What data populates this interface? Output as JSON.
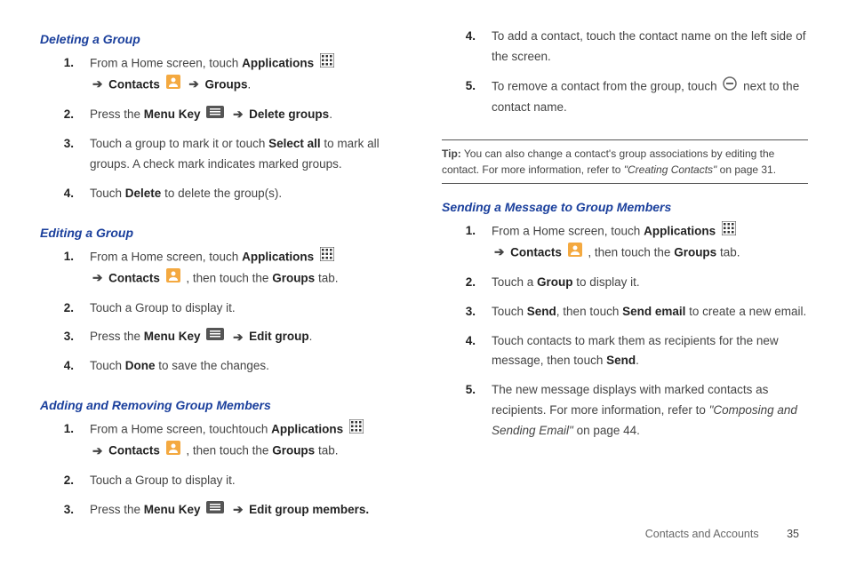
{
  "left": {
    "h1": "Deleting a Group",
    "s1": [
      {
        "n": "1.",
        "pre": "From a Home screen, touch ",
        "b1": "Applications",
        "mid": " ",
        "arrow1": "➔",
        "b2": "Contacts",
        "arrow2": "➔",
        "b3": "Groups",
        "post": "."
      },
      {
        "n": "2.",
        "pre": "Press the ",
        "b1": "Menu Key",
        "arrow1": "➔",
        "b2": "Delete groups",
        "post": "."
      },
      {
        "n": "3.",
        "pre": "Touch a group to mark it or touch ",
        "b1": "Select all",
        "post": " to mark all groups. A check mark indicates marked groups."
      },
      {
        "n": "4.",
        "pre": "Touch ",
        "b1": "Delete",
        "post": " to delete the group(s)."
      }
    ],
    "h2": "Editing a Group",
    "s2": [
      {
        "n": "1.",
        "pre": "From a Home screen, touch ",
        "b1": "Applications",
        "arrow1": "➔",
        "b2": "Contacts",
        "mid": " , then touch the ",
        "b3": "Groups",
        "post": " tab."
      },
      {
        "n": "2.",
        "pre": "Touch a Group to display it."
      },
      {
        "n": "3.",
        "pre": "Press the ",
        "b1": "Menu Key",
        "arrow1": "➔",
        "b2": "Edit group",
        "post": "."
      },
      {
        "n": "4.",
        "pre": "Touch ",
        "b1": "Done",
        "post": " to save the changes."
      }
    ],
    "h3": "Adding and Removing Group Members",
    "s3": [
      {
        "n": "1.",
        "pre": "From a Home screen, touchtouch ",
        "b1": "Applications",
        "arrow1": "➔",
        "b2": "Contacts",
        "mid": " , then touch the ",
        "b3": "Groups",
        "post": " tab."
      },
      {
        "n": "2.",
        "pre": "Touch a Group to display it."
      },
      {
        "n": "3.",
        "pre": "Press the ",
        "b1": "Menu Key",
        "arrow1": "➔",
        "b2": "Edit group members."
      }
    ]
  },
  "right": {
    "s0": [
      {
        "n": "4.",
        "pre": "To add a contact, touch the contact name on the left side of the screen."
      },
      {
        "n": "5.",
        "pre": "To remove a contact from the group, touch ",
        "post": " next to the contact name."
      }
    ],
    "tip": {
      "label": "Tip:",
      "text": " You can also change a contact's group associations by editing the contact. For more information, refer to ",
      "ref": "\"Creating Contacts\"",
      "page": " on page 31."
    },
    "h1": "Sending a Message to Group Members",
    "s1": [
      {
        "n": "1.",
        "pre": "From a Home screen, touch ",
        "b1": "Applications",
        "arrow1": "➔",
        "b2": "Contacts",
        "mid": " , then touch the ",
        "b3": "Groups",
        "post": " tab."
      },
      {
        "n": "2.",
        "pre": "Touch a ",
        "b1": "Group",
        "post": " to display it."
      },
      {
        "n": "3.",
        "pre": "Touch ",
        "b1": "Send",
        "mid": ", then touch ",
        "b2": "Send email",
        "post": " to create a new email."
      },
      {
        "n": "4.",
        "pre": "Touch contacts to mark them as recipients for the new message, then touch ",
        "b1": "Send",
        "post": "."
      },
      {
        "n": "5.",
        "pre": "The new message displays with marked contacts as recipients. For more information, refer to ",
        "ref": "\"Composing and Sending Email\"",
        "page": " on page 44."
      }
    ]
  },
  "footer": {
    "section": "Contacts and Accounts",
    "page": "35"
  }
}
